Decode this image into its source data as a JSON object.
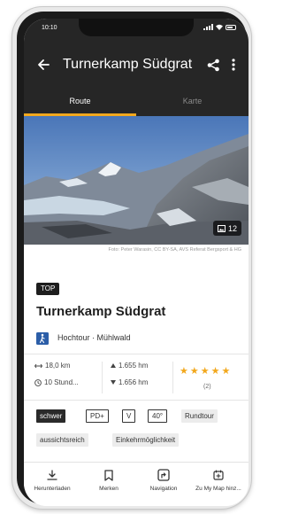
{
  "status_bar": {
    "time": "10:10"
  },
  "app_bar": {
    "title": "Turnerkamp Südgrat"
  },
  "tabs": [
    {
      "label": "Route",
      "active": true
    },
    {
      "label": "Karte",
      "active": false
    }
  ],
  "header_image": {
    "photo_count": "12",
    "credit": "Foto: Peter Warasin, CC BY-SA, AVS Referat Bergsport & HG"
  },
  "tour": {
    "badge": "TOP",
    "title": "Turnerkamp Südgrat",
    "type_line": "Hochtour · Mühlwald"
  },
  "stats": {
    "distance": "18,0 km",
    "duration": "10 Stund...",
    "ascent": "1.655 hm",
    "descent": "1.656 hm",
    "rating": 5,
    "rating_count": "(2)"
  },
  "tags": {
    "difficulty": "schwer",
    "grade": "PD+",
    "climbing": "V",
    "steepness": "40°",
    "round_tour": "Rundtour",
    "scenic": "aussichtsreich",
    "hut": "Einkehrmöglichkeit"
  },
  "bottom_nav": [
    {
      "label": "Herunterladen",
      "icon": "download-icon"
    },
    {
      "label": "Merken",
      "icon": "bookmark-icon"
    },
    {
      "label": "Navigation",
      "icon": "navigation-icon"
    },
    {
      "label": "Zu My Map hinz...",
      "icon": "add-to-map-icon"
    }
  ],
  "colors": {
    "app_bar": "#262626",
    "accent": "#f2a81d",
    "text_dark": "#1f1f1f"
  }
}
